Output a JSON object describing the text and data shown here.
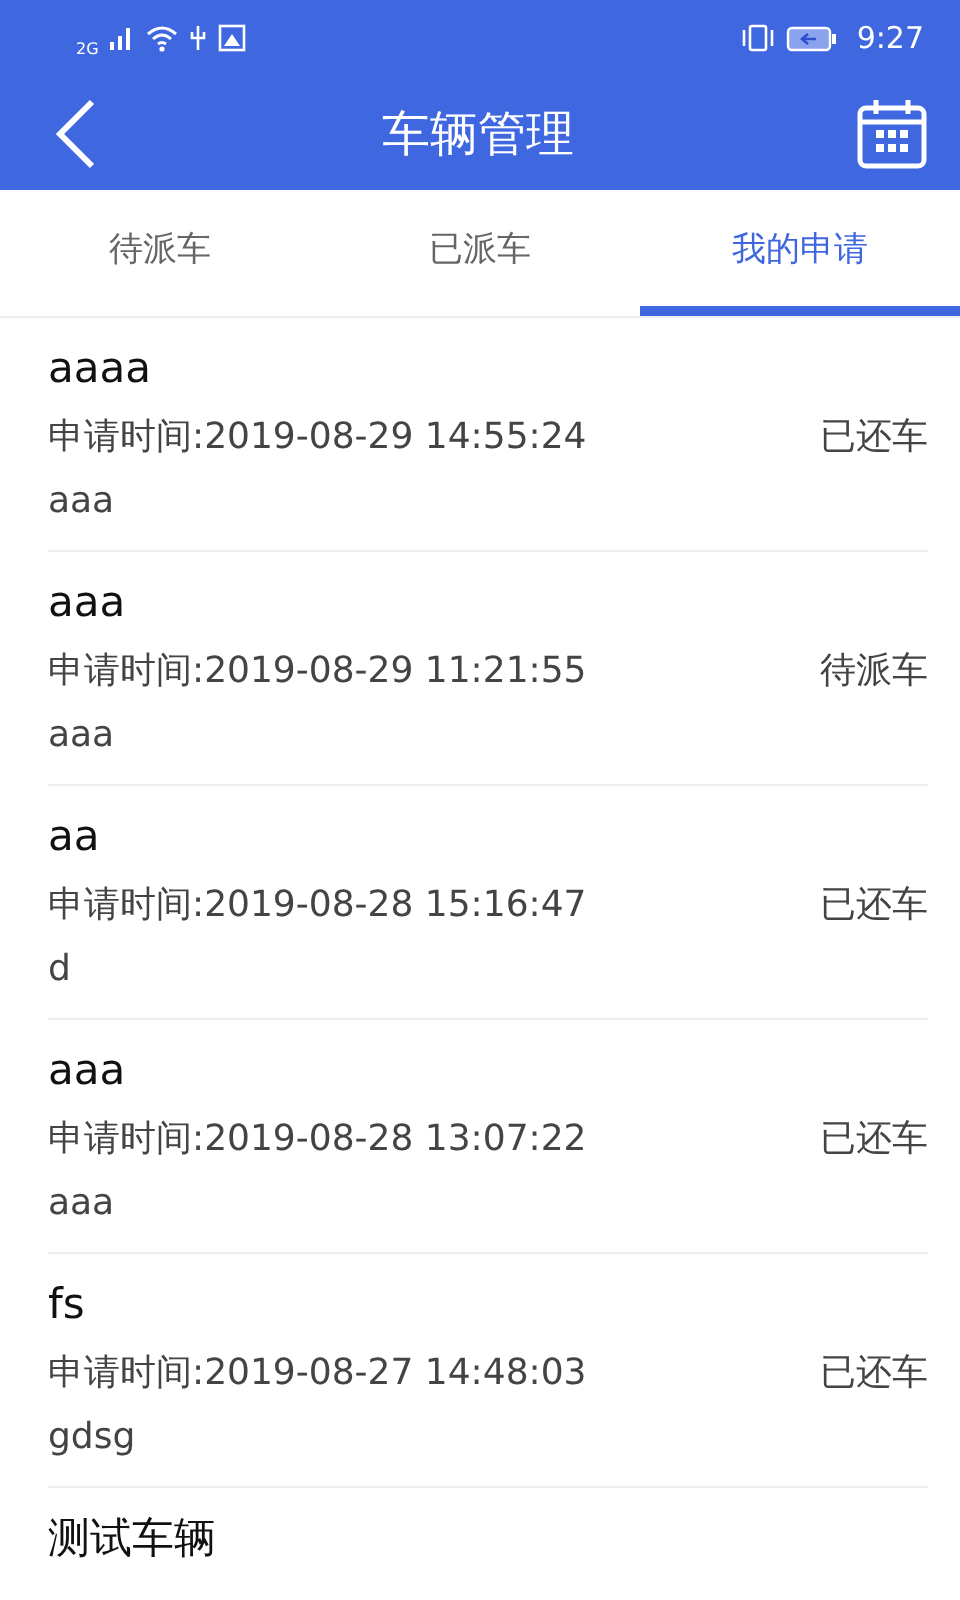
{
  "status_bar": {
    "network": "2G",
    "time": "9:27"
  },
  "header": {
    "title": "车辆管理"
  },
  "tabs": [
    {
      "label": "待派车",
      "selected": false
    },
    {
      "label": "已派车",
      "selected": false
    },
    {
      "label": "我的申请",
      "selected": true
    }
  ],
  "applications": [
    {
      "title": "aaaa",
      "time": "申请时间:2019-08-29 14:55:24",
      "status": "已还车",
      "note": "aaa"
    },
    {
      "title": "aaa",
      "time": "申请时间:2019-08-29 11:21:55",
      "status": "待派车",
      "note": "aaa"
    },
    {
      "title": "aa",
      "time": "申请时间:2019-08-28 15:16:47",
      "status": "已还车",
      "note": "d"
    },
    {
      "title": "aaa",
      "time": "申请时间:2019-08-28 13:07:22",
      "status": "已还车",
      "note": "aaa"
    },
    {
      "title": "fs",
      "time": "申请时间:2019-08-27 14:48:03",
      "status": "已还车",
      "note": "gdsg"
    },
    {
      "title": "测试车辆"
    }
  ]
}
